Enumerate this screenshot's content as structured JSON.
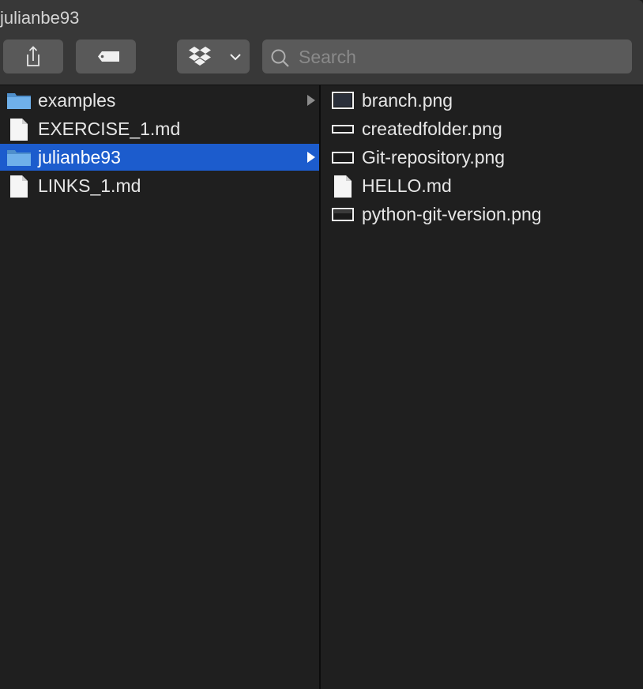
{
  "window": {
    "title": "julianbe93"
  },
  "toolbar": {
    "share_icon": "share-icon",
    "tag_icon": "tag-icon",
    "dropbox_icon": "dropbox-icon",
    "search_placeholder": "Search"
  },
  "left_column": {
    "items": [
      {
        "label": "examples",
        "icon": "folder-icon",
        "selected": false,
        "has_children": true
      },
      {
        "label": "EXERCISE_1.md",
        "icon": "document-icon",
        "selected": false,
        "has_children": false
      },
      {
        "label": "julianbe93",
        "icon": "folder-icon",
        "selected": true,
        "has_children": true
      },
      {
        "label": "LINKS_1.md",
        "icon": "document-icon",
        "selected": false,
        "has_children": false
      }
    ]
  },
  "right_column": {
    "items": [
      {
        "label": "branch.png",
        "icon": "image-thumbnail-icon"
      },
      {
        "label": "createdfolder.png",
        "icon": "image-thumbnail-icon"
      },
      {
        "label": "Git-repository.png",
        "icon": "image-thumbnail-icon"
      },
      {
        "label": "HELLO.md",
        "icon": "document-icon"
      },
      {
        "label": "python-git-version.png",
        "icon": "image-thumbnail-icon"
      }
    ]
  },
  "colors": {
    "selection": "#1c5ccd",
    "folder": "#5fa4e0",
    "background": "#1f1f1f",
    "toolbar": "#383838"
  }
}
